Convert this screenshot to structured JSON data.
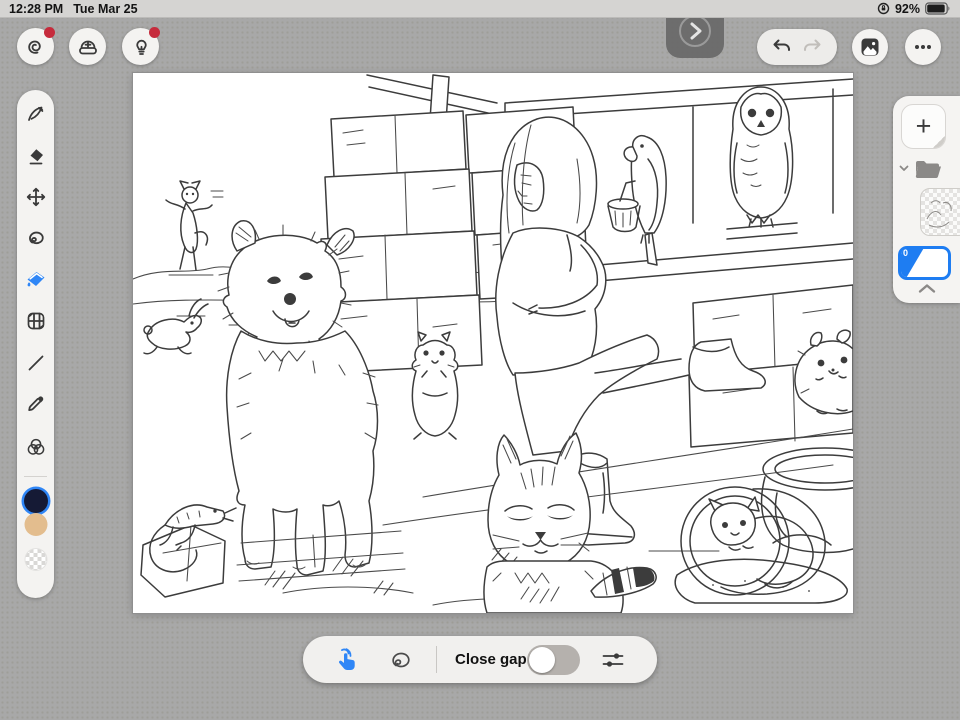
{
  "status_bar": {
    "time": "12:28 PM",
    "date": "Tue Mar 25",
    "battery_percent": "92%"
  },
  "top_toolbar": {
    "left_buttons": [
      {
        "name": "brand-spiral",
        "has_notification": true
      },
      {
        "name": "import-tray",
        "has_notification": false
      },
      {
        "name": "tips-lightbulb",
        "has_notification": true
      }
    ],
    "center_button": "expand-panel",
    "undo_enabled": true,
    "redo_enabled": false
  },
  "left_toolbar": {
    "tools": [
      "draw",
      "erase",
      "move",
      "lasso",
      "fill",
      "pattern",
      "line",
      "eyedropper",
      "color-wheel"
    ],
    "selected_tool": "fill",
    "swatches": [
      {
        "name": "navy",
        "hex": "#151a35",
        "selected": true
      },
      {
        "name": "tan",
        "hex": "#e3bd8e",
        "selected": false
      },
      {
        "name": "transparent",
        "hex": "checker",
        "selected": false
      }
    ]
  },
  "layers_panel": {
    "add_label": "+",
    "active_layer_badge": "0"
  },
  "bottom_toolbar": {
    "close_gap_label": "Close gap",
    "toggle_on": false
  },
  "canvas": {
    "alt": "Line-art coloring page: girl seated on hay bales with parrot on knee, owl on sill, fluffy dog, grumpy cat, rabbit, squirrel, lizard on rock, hamster, and kitten in a tipped fishbowl"
  },
  "colors": {
    "accent_blue": "#1e87f0",
    "badge_red": "#c62b3c",
    "background_gray": "#a8a8a8",
    "panel_light": "#f4f3f1",
    "selected_layer_border": "#1e7df2"
  }
}
